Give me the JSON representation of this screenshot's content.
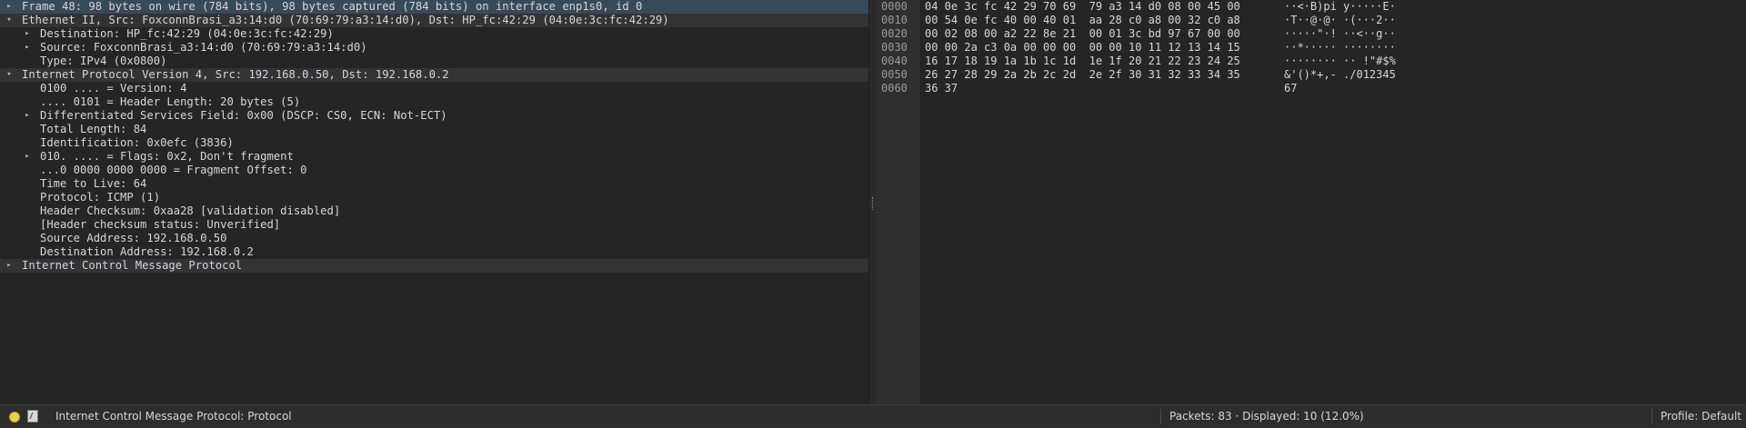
{
  "packet_details": {
    "rows": [
      {
        "label": "Frame 48: 98 bytes on wire (784 bits), 98 bytes captured (784 bits) on interface enp1s0, id 0",
        "indent": 0,
        "arrow": "collapsed",
        "style": "selected"
      },
      {
        "label": "Ethernet II, Src: FoxconnBrasi_a3:14:d0 (70:69:79:a3:14:d0), Dst: HP_fc:42:29 (04:0e:3c:fc:42:29)",
        "indent": 0,
        "arrow": "expanded",
        "style": "header"
      },
      {
        "label": "Destination: HP_fc:42:29 (04:0e:3c:fc:42:29)",
        "indent": 1,
        "arrow": "collapsed",
        "style": ""
      },
      {
        "label": "Source: FoxconnBrasi_a3:14:d0 (70:69:79:a3:14:d0)",
        "indent": 1,
        "arrow": "collapsed",
        "style": ""
      },
      {
        "label": "Type: IPv4 (0x0800)",
        "indent": 1,
        "arrow": "none",
        "style": ""
      },
      {
        "label": "Internet Protocol Version 4, Src: 192.168.0.50, Dst: 192.168.0.2",
        "indent": 0,
        "arrow": "expanded",
        "style": "header"
      },
      {
        "label": "0100 .... = Version: 4",
        "indent": 1,
        "arrow": "none",
        "style": ""
      },
      {
        "label": ".... 0101 = Header Length: 20 bytes (5)",
        "indent": 1,
        "arrow": "none",
        "style": ""
      },
      {
        "label": "Differentiated Services Field: 0x00 (DSCP: CS0, ECN: Not-ECT)",
        "indent": 1,
        "arrow": "collapsed",
        "style": ""
      },
      {
        "label": "Total Length: 84",
        "indent": 1,
        "arrow": "none",
        "style": ""
      },
      {
        "label": "Identification: 0x0efc (3836)",
        "indent": 1,
        "arrow": "none",
        "style": ""
      },
      {
        "label": "010. .... = Flags: 0x2, Don't fragment",
        "indent": 1,
        "arrow": "collapsed",
        "style": ""
      },
      {
        "label": "...0 0000 0000 0000 = Fragment Offset: 0",
        "indent": 1,
        "arrow": "none",
        "style": ""
      },
      {
        "label": "Time to Live: 64",
        "indent": 1,
        "arrow": "none",
        "style": ""
      },
      {
        "label": "Protocol: ICMP (1)",
        "indent": 1,
        "arrow": "none",
        "style": ""
      },
      {
        "label": "Header Checksum: 0xaa28 [validation disabled]",
        "indent": 1,
        "arrow": "none",
        "style": ""
      },
      {
        "label": "[Header checksum status: Unverified]",
        "indent": 1,
        "arrow": "none",
        "style": ""
      },
      {
        "label": "Source Address: 192.168.0.50",
        "indent": 1,
        "arrow": "none",
        "style": ""
      },
      {
        "label": "Destination Address: 192.168.0.2",
        "indent": 1,
        "arrow": "none",
        "style": ""
      },
      {
        "label": "Internet Control Message Protocol",
        "indent": 0,
        "arrow": "collapsed",
        "style": "header"
      }
    ]
  },
  "packet_bytes": {
    "offsets": [
      "0000",
      "0010",
      "0020",
      "0030",
      "0040",
      "0050",
      "0060"
    ],
    "hex": [
      "04 0e 3c fc 42 29 70 69  79 a3 14 d0 08 00 45 00",
      "00 54 0e fc 40 00 40 01  aa 28 c0 a8 00 32 c0 a8",
      "00 02 08 00 a2 22 8e 21  00 01 3c bd 97 67 00 00",
      "00 00 2a c3 0a 00 00 00  00 00 10 11 12 13 14 15",
      "16 17 18 19 1a 1b 1c 1d  1e 1f 20 21 22 23 24 25",
      "26 27 28 29 2a 2b 2c 2d  2e 2f 30 31 32 33 34 35",
      "36 37"
    ],
    "ascii": [
      "··<·B)pi y·····E·",
      "·T··@·@· ·(···2··",
      "·····\"·! ··<··g··",
      "··*····· ········",
      "········ ·· !\"#$%",
      "&'()*+,- ./012345",
      "67"
    ]
  },
  "status_bar": {
    "selected_field": "Internet Control Message Protocol: Protocol",
    "packets": "Packets: 83 · Displayed: 10 (12.0%)",
    "profile": "Profile: Default"
  },
  "icons": {
    "arrow_collapsed": "▸",
    "arrow_expanded": "▾",
    "expert_info": "expert-info-icon",
    "capture_comment": "capture-comment-icon"
  }
}
